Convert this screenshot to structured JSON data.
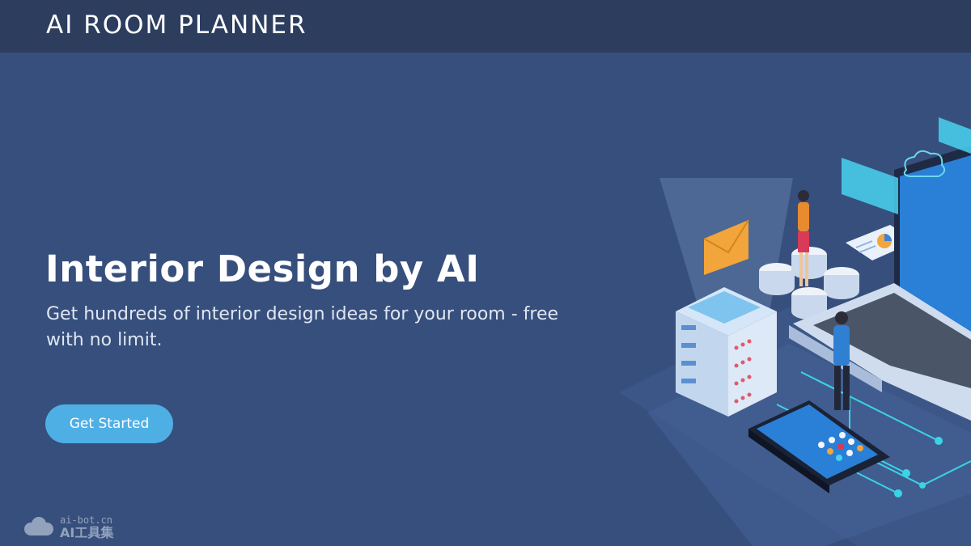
{
  "header": {
    "brand": "AI ROOM PLANNER"
  },
  "hero": {
    "title": "Interior Design by AI",
    "subtitle": "Get hundreds of interior design ideas for your room - free with no limit.",
    "cta_label": "Get Started"
  },
  "illustration": {
    "icon": "isometric-tech-illustration"
  },
  "watermark": {
    "url": "ai-bot.cn",
    "name": "AI工具集"
  },
  "colors": {
    "background": "#374f7c",
    "header": "#2c3d5e",
    "accent": "#4eafe4",
    "text": "#ffffff"
  }
}
